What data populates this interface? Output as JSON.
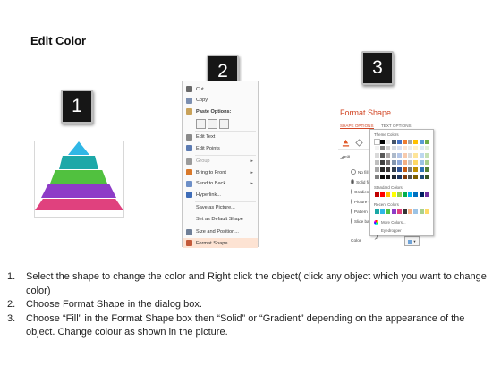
{
  "page": {
    "title": "Edit Color"
  },
  "badges": [
    "1",
    "2",
    "3"
  ],
  "pyramid": {
    "colors": [
      "#2fb7e6",
      "#1da8a8",
      "#51c13f",
      "#8e3cc7",
      "#e0417e"
    ]
  },
  "context_menu": {
    "items": [
      {
        "label": "Cut",
        "icon": "scissors-icon",
        "icon_color": "#6a6a6a"
      },
      {
        "label": "Copy",
        "icon": "copy-icon",
        "icon_color": "#7c8fb0"
      },
      {
        "label": "Paste Options:",
        "icon": "paste-icon",
        "icon_color": "#c9a25a",
        "bold": true
      },
      {
        "label": "",
        "icon": "",
        "icon_color": "",
        "paste_row": true
      },
      {
        "label": "Edit Text",
        "icon": "edit-text-icon",
        "icon_color": "#8a8a8a"
      },
      {
        "label": "Edit Points",
        "icon": "edit-points-icon",
        "icon_color": "#5c7bb2"
      },
      {
        "label": "Group",
        "icon": "group-icon",
        "icon_color": "#9b9b9b",
        "disabled": true,
        "submenu": true
      },
      {
        "label": "Bring to Front",
        "icon": "bring-to-front-icon",
        "icon_color": "#d9792b",
        "submenu": true
      },
      {
        "label": "Send to Back",
        "icon": "send-to-back-icon",
        "icon_color": "#6d8fc7",
        "submenu": true
      },
      {
        "label": "Hyperlink...",
        "icon": "hyperlink-icon",
        "icon_color": "#3f6db8"
      },
      {
        "label": "Save as Picture...",
        "icon": "",
        "icon_color": ""
      },
      {
        "label": "Set as Default Shape",
        "icon": "",
        "icon_color": ""
      },
      {
        "label": "Size and Position...",
        "icon": "size-position-icon",
        "icon_color": "#6f7f97"
      },
      {
        "label": "Format Shape...",
        "icon": "format-shape-icon",
        "icon_color": "#c35a3a",
        "highlight": true
      }
    ]
  },
  "format_shape": {
    "title": "Format Shape",
    "tabs": [
      "SHAPE OPTIONS",
      "TEXT OPTIONS"
    ],
    "fill_label": "Fill",
    "fill_options": [
      {
        "label": "No fill",
        "selected": false
      },
      {
        "label": "Solid fill",
        "selected": true
      },
      {
        "label": "Gradient fill",
        "selected": false
      },
      {
        "label": "Picture or texture fill",
        "selected": false
      },
      {
        "label": "Pattern fill",
        "selected": false
      },
      {
        "label": "Slide background fill",
        "selected": false
      }
    ],
    "color_label": "Color",
    "palette": {
      "theme_label": "Theme Colors",
      "standard_label": "Standard Colors",
      "recent_label": "Recent Colors",
      "more_colors": "More Colors...",
      "eyedropper": "Eyedropper",
      "theme_top": [
        "#ffffff",
        "#000000",
        "#e7e6e6",
        "#44546a",
        "#4472c4",
        "#ed7d31",
        "#a5a5a5",
        "#ffc000",
        "#5b9bd5",
        "#70ad47"
      ],
      "theme_cols": [
        [
          "#f2f2f2",
          "#d9d9d9",
          "#bfbfbf",
          "#a6a6a6",
          "#808080"
        ],
        [
          "#7f7f7f",
          "#595959",
          "#404040",
          "#262626",
          "#0d0d0d"
        ],
        [
          "#d0cece",
          "#aeaaaa",
          "#757171",
          "#3b3838",
          "#171616"
        ],
        [
          "#d6dce4",
          "#adb9ca",
          "#8497b0",
          "#333f4f",
          "#222a35"
        ],
        [
          "#d9e2f3",
          "#b4c6e7",
          "#8eaadb",
          "#2f5496",
          "#1f3864"
        ],
        [
          "#fbe5d5",
          "#f7caac",
          "#f4b083",
          "#c55a11",
          "#833c0b"
        ],
        [
          "#ededed",
          "#dbdbdb",
          "#c9c9c9",
          "#7b7b7b",
          "#525252"
        ],
        [
          "#fff2cc",
          "#fee599",
          "#ffd965",
          "#bf8f00",
          "#7f6000"
        ],
        [
          "#deebf6",
          "#bdd7ee",
          "#9cc3e5",
          "#2e75b5",
          "#1e4e79"
        ],
        [
          "#e2efd9",
          "#c5e0b3",
          "#a8d08d",
          "#538135",
          "#375623"
        ]
      ],
      "standard": [
        "#c00000",
        "#ff0000",
        "#ffc000",
        "#ffff00",
        "#92d050",
        "#00b050",
        "#00b0f0",
        "#0070c0",
        "#002060",
        "#7030a0"
      ],
      "recent": [
        "#1aa7a5",
        "#2fb7e6",
        "#51c13f",
        "#8e3cc7",
        "#e0417e",
        "#333333",
        "#f4b083",
        "#9cc3e5",
        "#a8d08d",
        "#ffd965"
      ]
    }
  },
  "instructions": [
    {
      "num": "1.",
      "text": "Select the shape to change the color and Right click the object( click any object which you want to change color)"
    },
    {
      "num": "2.",
      "text": "Choose Format Shape in the dialog box."
    },
    {
      "num": "3.",
      "text": "Choose “Fill” in the Format Shape box then “Solid” or “Gradient” depending on the appearance of the object. Change colour as shown in the picture."
    }
  ]
}
